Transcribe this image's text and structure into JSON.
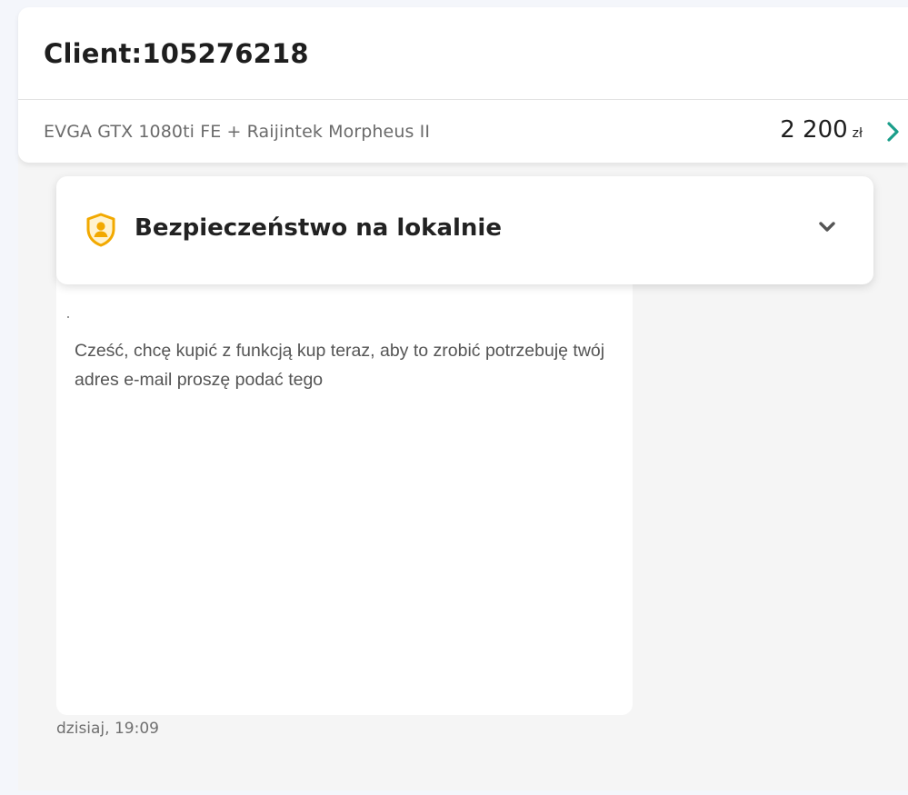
{
  "header": {
    "client_title": "Client:105276218"
  },
  "offer": {
    "title": "EVGA GTX 1080ti FE + Raijintek Morpheus II",
    "price_amount": "2 200",
    "price_currency": "zł"
  },
  "safety": {
    "title": "Bezpieczeństwo na lokalnie"
  },
  "message": {
    "image_text": "Cześć, chcę kupić z funkcją kup teraz, aby to zrobić potrzebuję twój adres e-mail proszę podać tego",
    "time": "dzisiaj, 19:09"
  },
  "colors": {
    "accent_green": "#1a9e8a",
    "shield_yellow": "#f2a900",
    "page_bg": "#f5f5f5"
  },
  "icons": {
    "offer_chevron": "chevron-right-icon",
    "safety_shield": "shield-icon",
    "safety_toggle": "chevron-down-icon"
  }
}
